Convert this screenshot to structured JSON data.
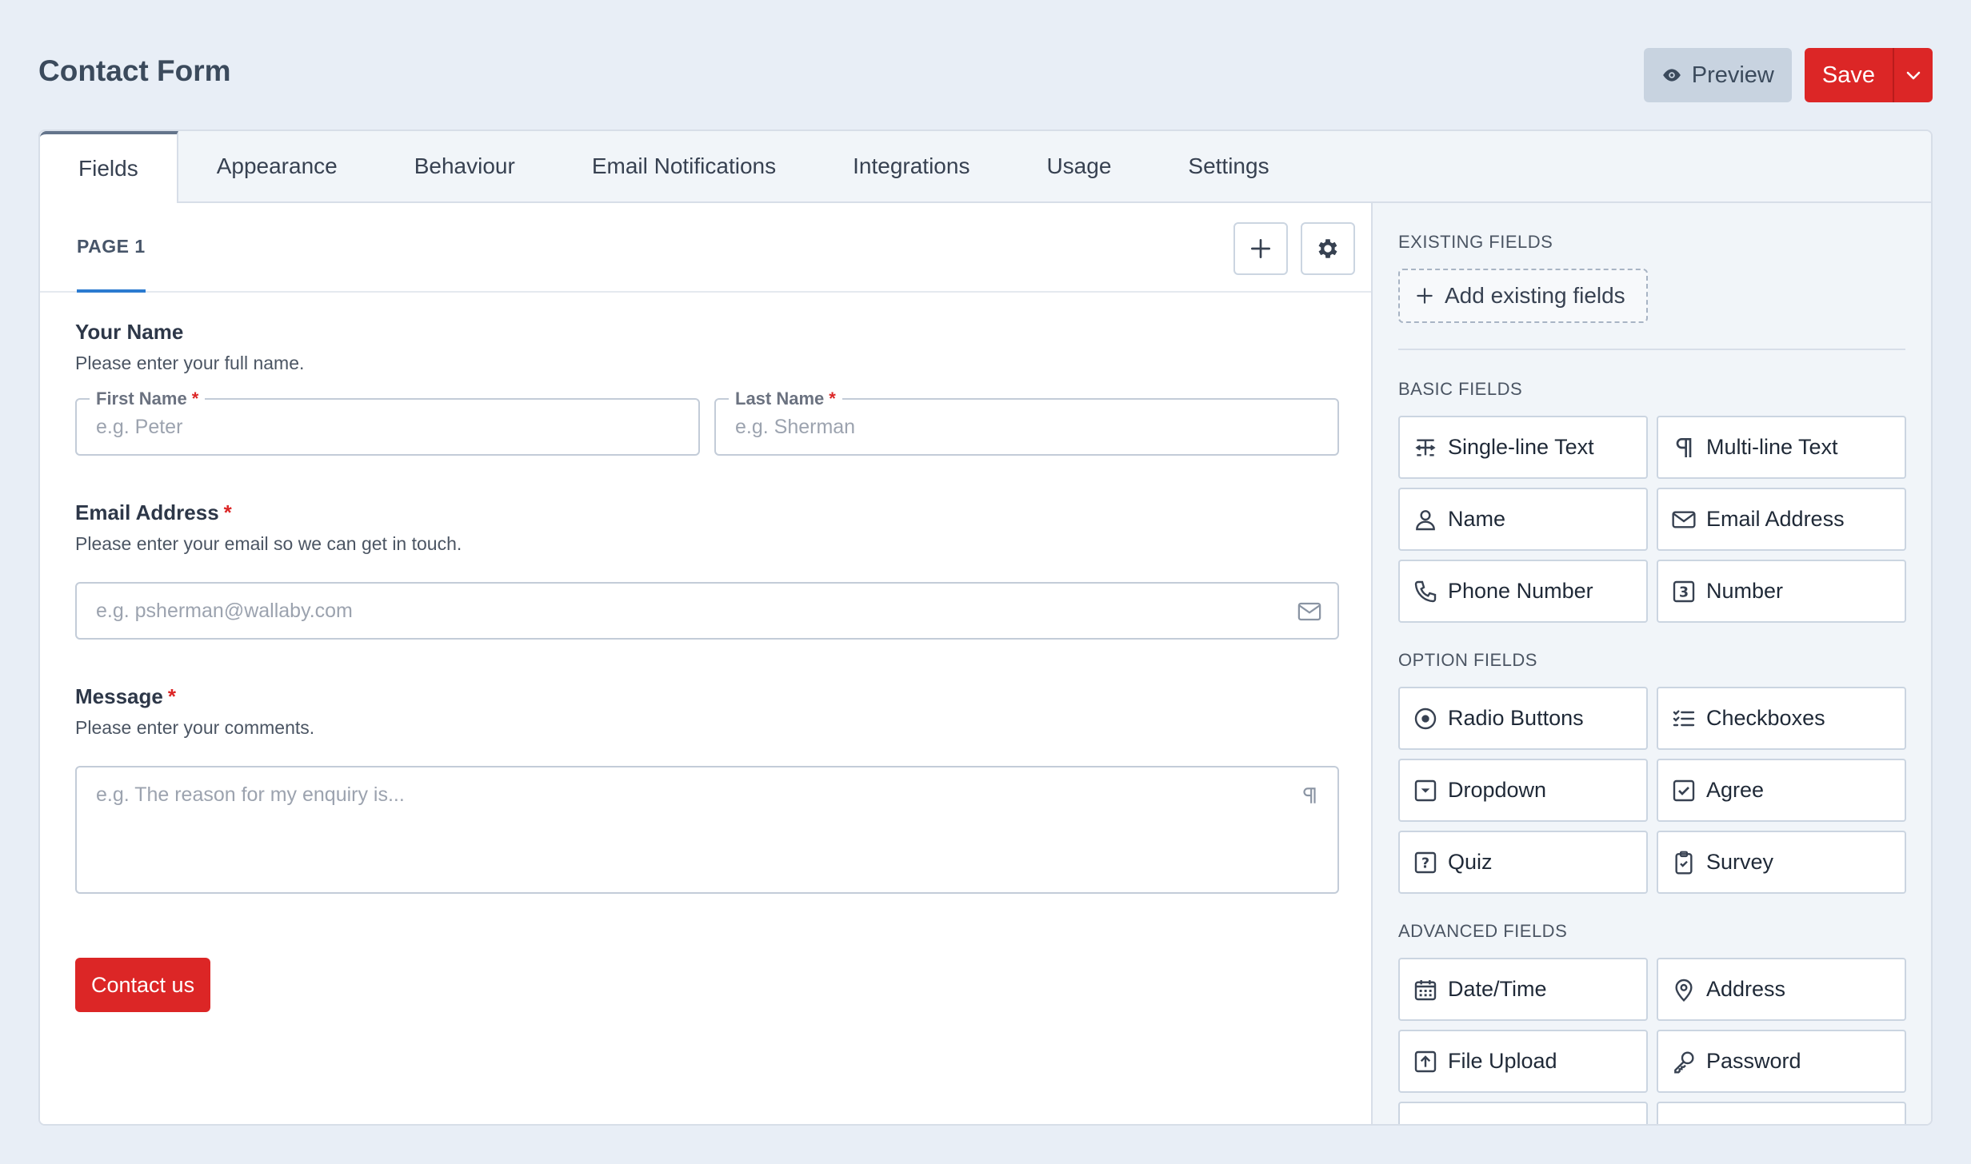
{
  "header": {
    "title": "Contact Form",
    "preview_label": "Preview",
    "save_label": "Save"
  },
  "tabs": [
    {
      "label": "Fields",
      "active": true
    },
    {
      "label": "Appearance"
    },
    {
      "label": "Behaviour"
    },
    {
      "label": "Email Notifications"
    },
    {
      "label": "Integrations"
    },
    {
      "label": "Usage"
    },
    {
      "label": "Settings"
    }
  ],
  "page_tab": "PAGE 1",
  "form": {
    "name": {
      "label": "Your Name",
      "desc": "Please enter your full name.",
      "first_label": "First Name",
      "first_placeholder": "e.g. Peter",
      "last_label": "Last Name",
      "last_placeholder": "e.g. Sherman"
    },
    "email": {
      "label": "Email Address",
      "desc": "Please enter your email so we can get in touch.",
      "placeholder": "e.g. psherman@wallaby.com"
    },
    "message": {
      "label": "Message",
      "desc": "Please enter your comments.",
      "placeholder": "e.g. The reason for my enquiry is..."
    },
    "submit_label": "Contact us",
    "required_mark": "*"
  },
  "sidebar": {
    "existing_title": "EXISTING FIELDS",
    "add_existing": "Add existing fields",
    "basic_title": "BASIC FIELDS",
    "basic": [
      {
        "label": "Single-line Text",
        "icon": "text-cursor-icon"
      },
      {
        "label": "Multi-line Text",
        "icon": "pilcrow-icon"
      },
      {
        "label": "Name",
        "icon": "user-icon"
      },
      {
        "label": "Email Address",
        "icon": "envelope-icon"
      },
      {
        "label": "Phone Number",
        "icon": "phone-icon"
      },
      {
        "label": "Number",
        "icon": "number-icon"
      }
    ],
    "option_title": "OPTION FIELDS",
    "option": [
      {
        "label": "Radio Buttons",
        "icon": "radio-icon"
      },
      {
        "label": "Checkboxes",
        "icon": "checklist-icon"
      },
      {
        "label": "Dropdown",
        "icon": "dropdown-icon"
      },
      {
        "label": "Agree",
        "icon": "checkbox-icon"
      },
      {
        "label": "Quiz",
        "icon": "question-icon"
      },
      {
        "label": "Survey",
        "icon": "clipboard-icon"
      }
    ],
    "advanced_title": "ADVANCED FIELDS",
    "advanced": [
      {
        "label": "Date/Time",
        "icon": "calendar-icon"
      },
      {
        "label": "Address",
        "icon": "map-pin-icon"
      },
      {
        "label": "File Upload",
        "icon": "upload-icon"
      },
      {
        "label": "Password",
        "icon": "key-icon"
      }
    ]
  }
}
